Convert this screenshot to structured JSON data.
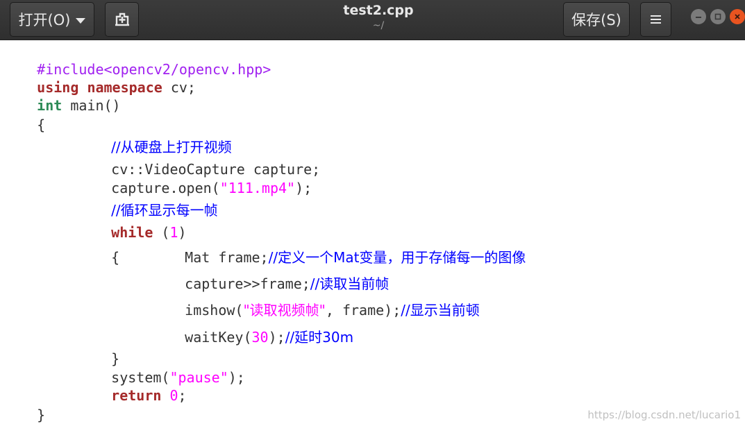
{
  "header": {
    "open_label": "打开(O)",
    "save_label": "保存(S)",
    "title": "test2.cpp",
    "subtitle": "~/"
  },
  "code": {
    "l1": {
      "a": "#include<opencv2/opencv.hpp>"
    },
    "l2": {
      "a": "using",
      "b": " ",
      "c": "namespace",
      "d": " cv;"
    },
    "l3": {
      "a": "int",
      "b": " main()"
    },
    "l4": {
      "a": "{"
    },
    "l5": {
      "a": "//从硬盘上打开视频"
    },
    "l6": {
      "a": "cv::VideoCapture capture;"
    },
    "l7": {
      "a": "capture.open(",
      "b": "\"111.mp4\"",
      "c": ");"
    },
    "l8": {
      "a": "//循环显示每一帧"
    },
    "l9": {
      "a": "while",
      "b": " (",
      "c": "1",
      "d": ")"
    },
    "l10": {
      "a": "{",
      "b": "Mat frame;",
      "c": "//定义一个Mat变量，用于存储每一的图像"
    },
    "l11": {
      "a": "capture>>frame;",
      "b": "//读取当前帧"
    },
    "l12": {
      "a": "imshow(",
      "b": "\"读取视频帧\"",
      "c": ", frame);",
      "d": "//显示当前顿"
    },
    "l13": {
      "a": "waitKey(",
      "b": "30",
      "c": ");",
      "d": "//延时30m"
    },
    "l14": {
      "a": "}"
    },
    "l15": {
      "a": "system(",
      "b": "\"pause\"",
      "c": ");"
    },
    "l16": {
      "a": "return",
      "b": " ",
      "c": "0",
      "d": ";"
    },
    "l17": {
      "a": "}"
    }
  },
  "watermark": "https://blog.csdn.net/lucario1",
  "colors": {
    "preprocessor": "#a020f0",
    "keyword": "#a52a2a",
    "type": "#2e8b57",
    "string": "#ff00ff",
    "comment": "#0000ff",
    "close_button": "#e95420"
  },
  "icons": [
    "caret-down-icon",
    "new-tab-icon",
    "hamburger-menu-icon",
    "minimize-icon",
    "maximize-icon",
    "close-icon"
  ]
}
